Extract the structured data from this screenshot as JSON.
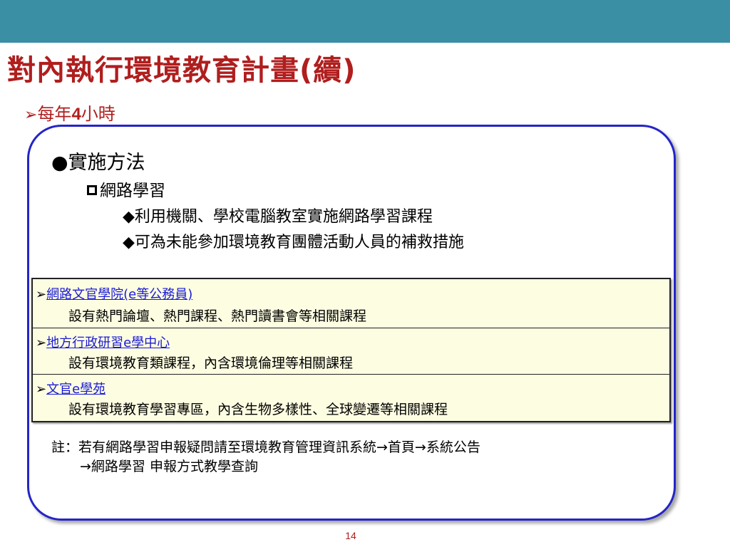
{
  "slide": {
    "title": "對內執行環境教育計畫(續)",
    "subtitle_prefix": "每年",
    "subtitle_number": "4",
    "subtitle_suffix": "小時",
    "page_number": "14"
  },
  "method": {
    "heading": "實施方法",
    "sub_heading": "網路學習",
    "bullets": [
      "利用機關、學校電腦教室實施網路學習課程",
      "可為未能參加環境教育團體活動人員的補救措施"
    ]
  },
  "table": {
    "rows": [
      {
        "link": "網路文官學院(e等公務員)",
        "desc": "設有熱門論壇、熱門課程、熱門讀書會等相關課程"
      },
      {
        "link": "地方行政研習e學中心",
        "desc": "設有環境教育類課程，內含環境倫理等相關課程"
      },
      {
        "link": "文官e學苑",
        "desc": "設有環境教育學習專區，內含生物多樣性、全球變遷等相關課程"
      }
    ]
  },
  "note": {
    "line1": "註：若有網路學習申報疑問請至環境教育管理資訊系統→首頁→系統公告",
    "line2": "→網路學習 申報方式教學查詢"
  },
  "colors": {
    "header_bar": "#3a8fa5",
    "title_red": "#b01e1e",
    "box_border": "#2424c8",
    "table_bg": "#fdfde2",
    "link_blue": "#1a1ad6"
  }
}
